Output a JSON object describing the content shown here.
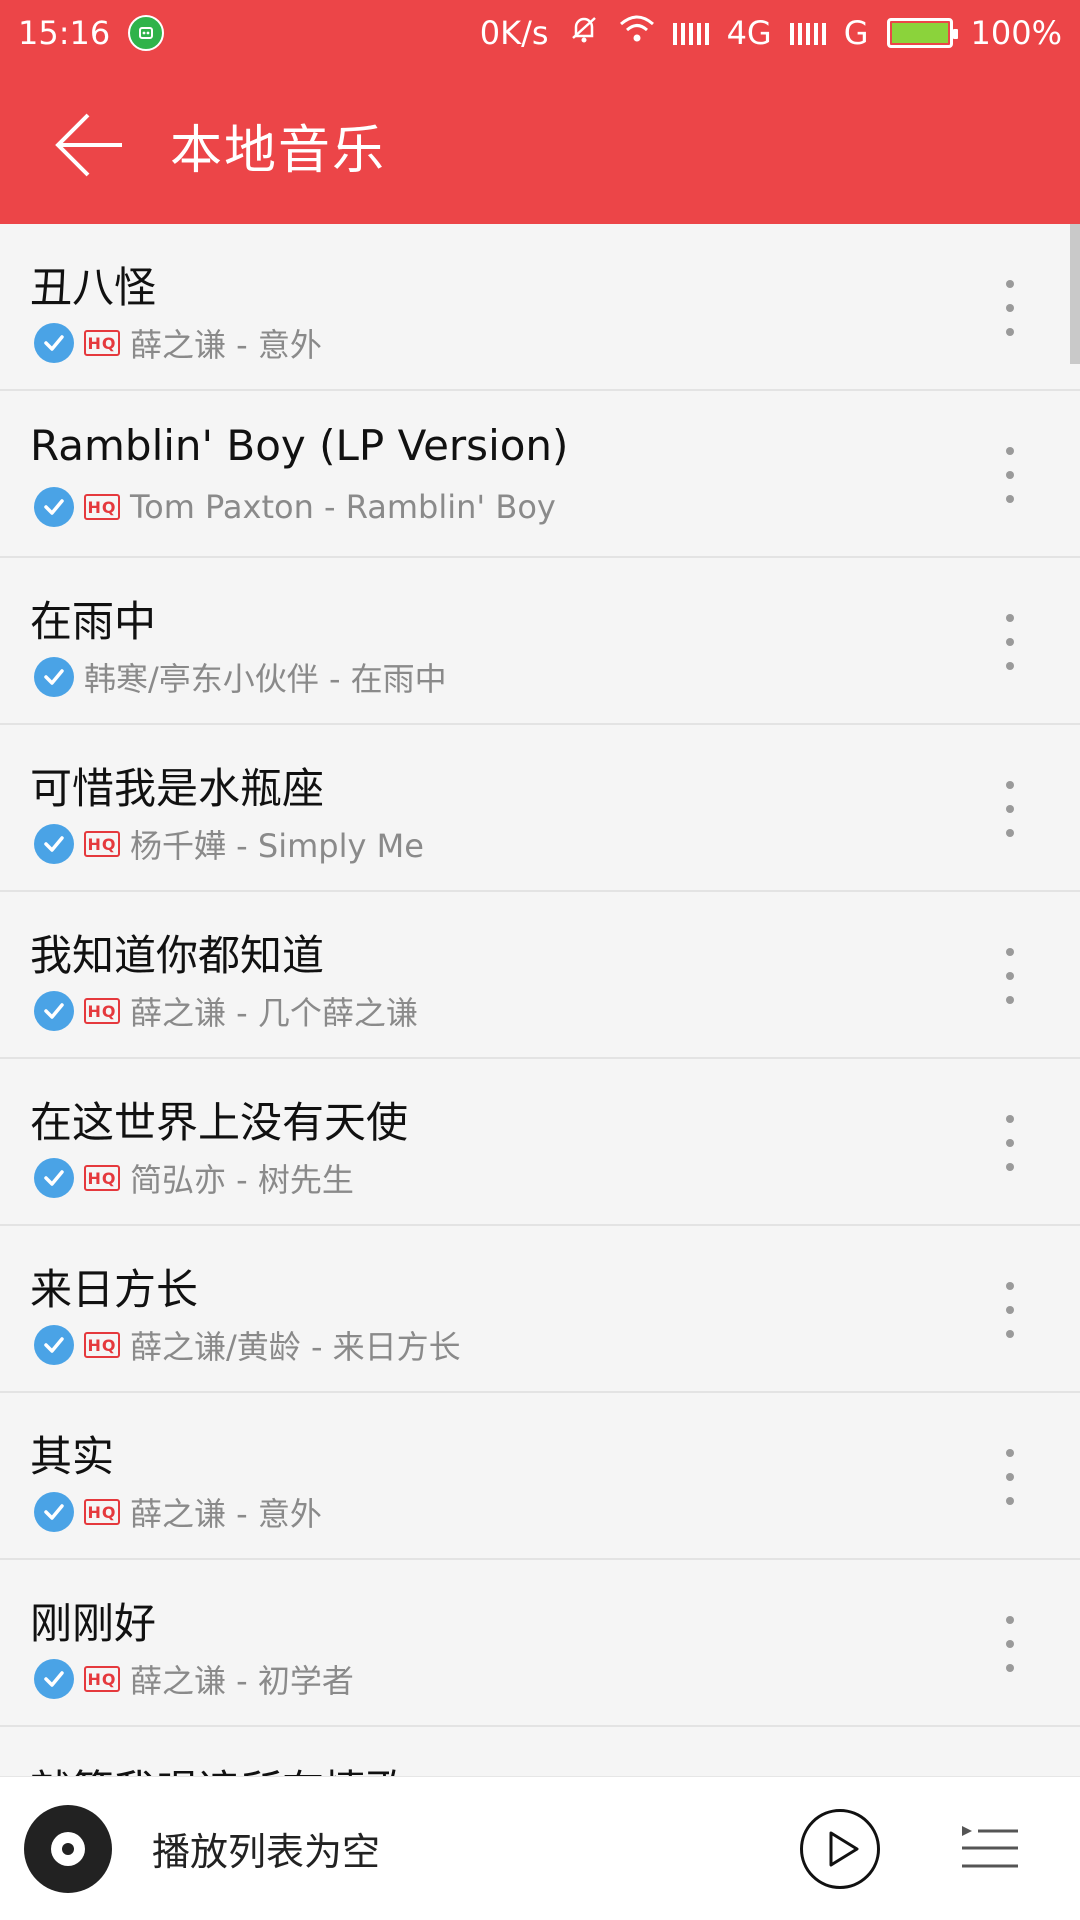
{
  "status_bar": {
    "time": "15:16",
    "network_speed": "0K/s",
    "network_4g": "4G",
    "network_g": "G",
    "battery": "100%"
  },
  "header": {
    "title": "本地音乐"
  },
  "songs": [
    {
      "title": "丑八怪",
      "meta": "薛之谦 - 意外",
      "hq": true
    },
    {
      "title": "Ramblin' Boy (LP Version)",
      "meta": "Tom Paxton - Ramblin' Boy",
      "hq": true
    },
    {
      "title": "在雨中",
      "meta": "韩寒/亭东小伙伴 - 在雨中",
      "hq": false
    },
    {
      "title": "可惜我是水瓶座",
      "meta": "杨千嬅 - Simply Me",
      "hq": true
    },
    {
      "title": "我知道你都知道",
      "meta": "薛之谦 - 几个薛之谦",
      "hq": true
    },
    {
      "title": "在这世界上没有天使",
      "meta": "简弘亦 - 树先生",
      "hq": true
    },
    {
      "title": "来日方长",
      "meta": "薛之谦/黄龄 - 来日方长",
      "hq": true
    },
    {
      "title": "其实",
      "meta": "薛之谦 - 意外",
      "hq": true
    },
    {
      "title": "刚刚好",
      "meta": "薛之谦 - 初学者",
      "hq": true
    },
    {
      "title": "就算我唱遍所有情歌",
      "meta": "",
      "hq": false
    }
  ],
  "hq_label": "HQ",
  "player": {
    "status": "播放列表为空"
  },
  "colors": {
    "accent": "#ec4548",
    "check": "#4aa3e6",
    "hq": "#e5393d"
  }
}
